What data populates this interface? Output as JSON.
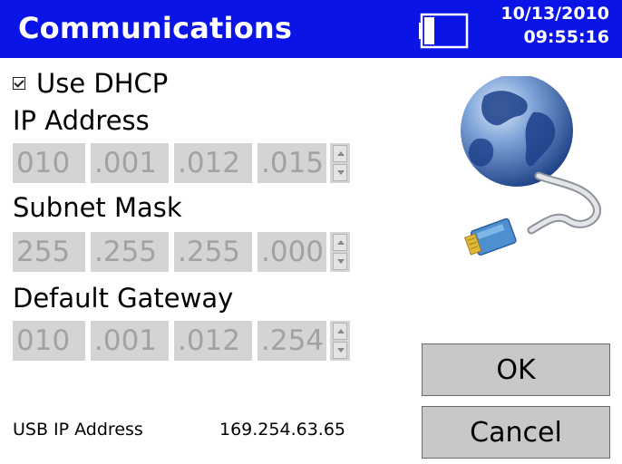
{
  "header": {
    "title": "Communications",
    "date": "10/13/2010",
    "time": "09:55:16"
  },
  "dhcp": {
    "label": "Use DHCP",
    "checked": true
  },
  "ip_address": {
    "label": "IP Address",
    "octets": [
      "010",
      ".001",
      ".012",
      ".015"
    ]
  },
  "subnet_mask": {
    "label": "Subnet Mask",
    "octets": [
      "255",
      ".255",
      ".255",
      ".000"
    ]
  },
  "default_gateway": {
    "label": "Default Gateway",
    "octets": [
      "010",
      ".001",
      ".012",
      ".254"
    ]
  },
  "usb": {
    "label": "USB IP Address",
    "value": "169.254.63.65"
  },
  "buttons": {
    "ok": "OK",
    "cancel": "Cancel"
  },
  "icons": {
    "battery": "battery-icon",
    "network": "network-globe-icon"
  },
  "colors": {
    "titlebar": "#0a14e6",
    "field_bg": "#d4d4d4",
    "field_text": "#a2a2a2",
    "button_bg": "#c8c8c8"
  }
}
